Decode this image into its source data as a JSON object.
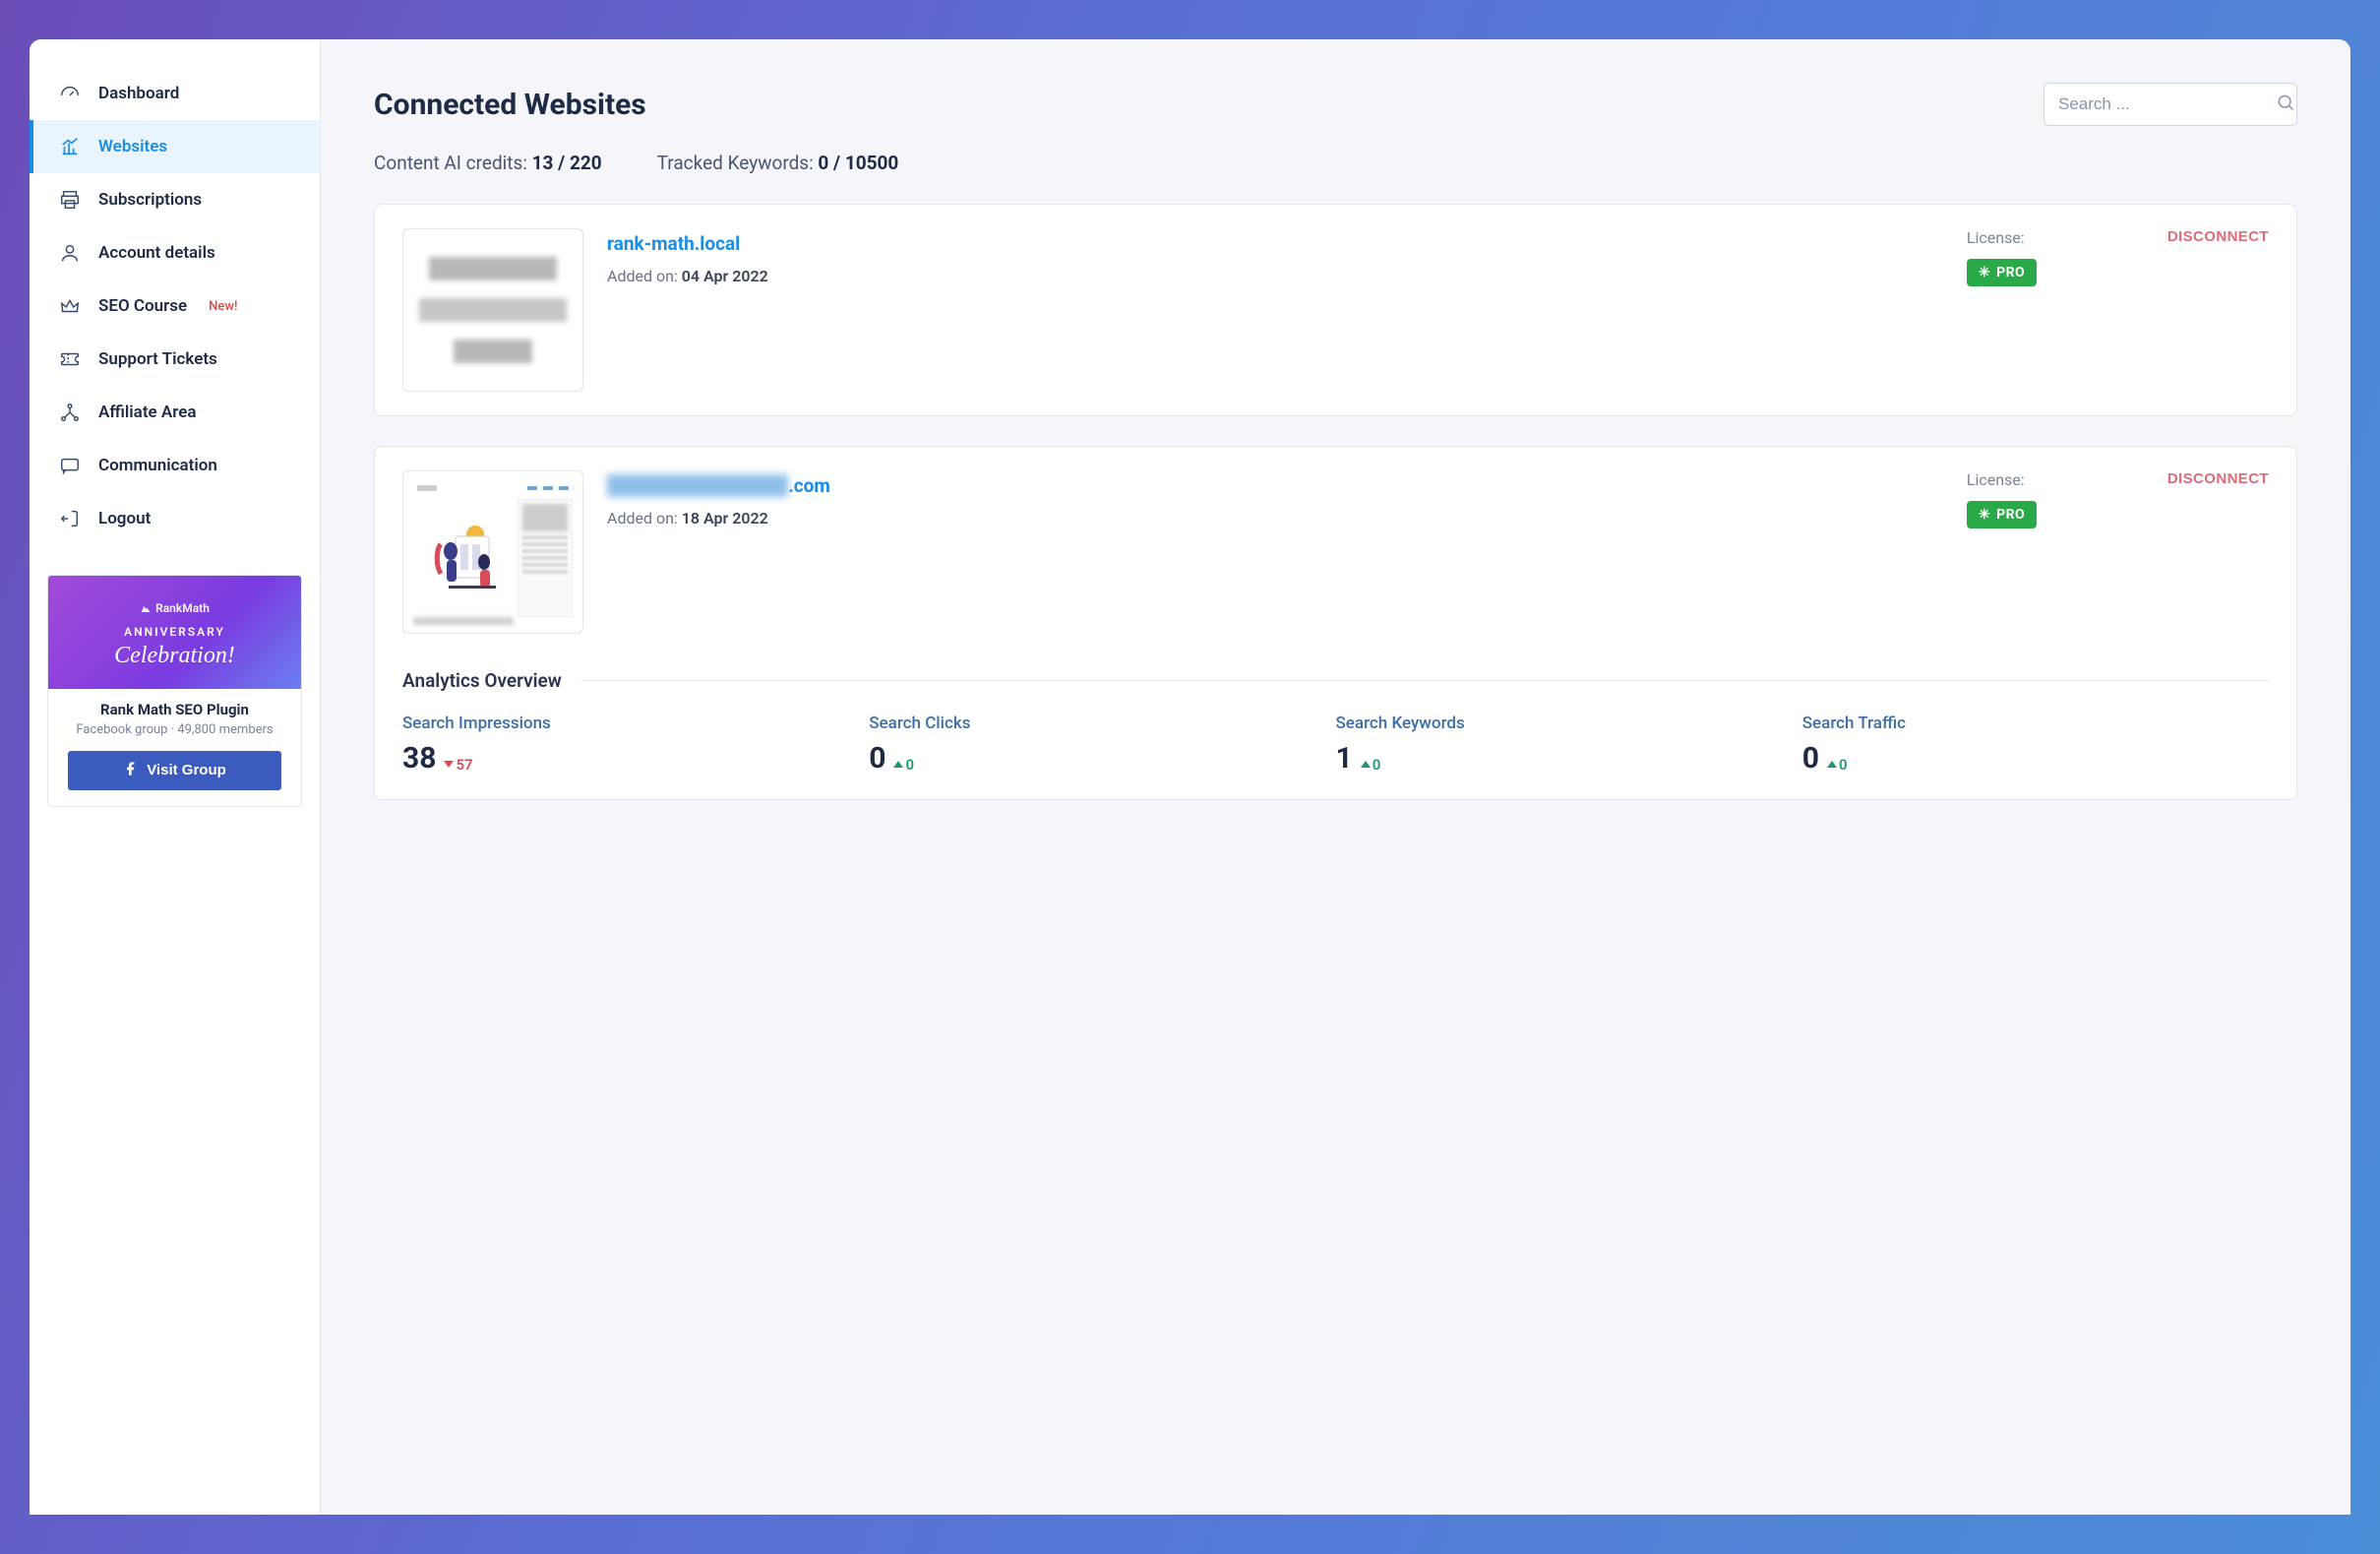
{
  "sidebar": {
    "items": [
      {
        "label": "Dashboard"
      },
      {
        "label": "Websites"
      },
      {
        "label": "Subscriptions"
      },
      {
        "label": "Account details"
      },
      {
        "label": "SEO Course",
        "badge": "New!"
      },
      {
        "label": "Support Tickets"
      },
      {
        "label": "Affiliate Area"
      },
      {
        "label": "Communication"
      },
      {
        "label": "Logout"
      }
    ],
    "promo": {
      "brand": "RankMath",
      "line1": "ANNIVERSARY",
      "line2": "Celebration!",
      "title": "Rank Math SEO Plugin",
      "sub": "Facebook group · 49,800 members",
      "button": "Visit Group"
    }
  },
  "header": {
    "title": "Connected Websites",
    "search_placeholder": "Search ..."
  },
  "stats": {
    "credits_label": "Content AI credits: ",
    "credits_value": "13 / 220",
    "keywords_label": "Tracked Keywords: ",
    "keywords_value": "0 / 10500"
  },
  "sites": [
    {
      "url": "rank-math.local",
      "added_label": "Added on: ",
      "added_date": "04 Apr 2022",
      "license_label": "License:",
      "license_tier": "PRO",
      "disconnect": "DISCONNECT"
    },
    {
      "url_suffix": ".com",
      "added_label": "Added on: ",
      "added_date": "18 Apr 2022",
      "license_label": "License:",
      "license_tier": "PRO",
      "disconnect": "DISCONNECT"
    }
  ],
  "analytics": {
    "title": "Analytics Overview",
    "metrics": [
      {
        "label": "Search Impressions",
        "value": "38",
        "delta": "57",
        "dir": "down"
      },
      {
        "label": "Search Clicks",
        "value": "0",
        "delta": "0",
        "dir": "up"
      },
      {
        "label": "Search Keywords",
        "value": "1",
        "delta": "0",
        "dir": "up"
      },
      {
        "label": "Search Traffic",
        "value": "0",
        "delta": "0",
        "dir": "up"
      }
    ]
  }
}
